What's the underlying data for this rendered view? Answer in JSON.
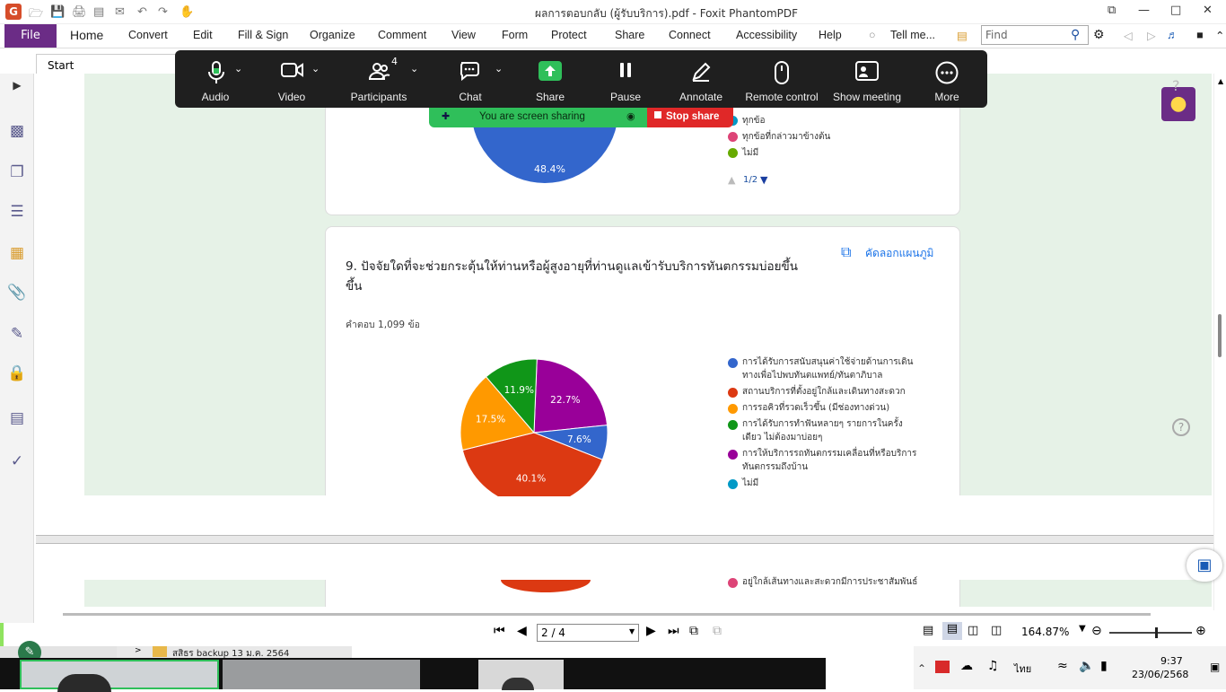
{
  "window": {
    "title": "ผลการตอบกลับ (ผู้รับบริการ).pdf - Foxit PhantomPDF"
  },
  "ribbon": {
    "file": "File",
    "tabs": [
      "Home",
      "Convert",
      "Edit",
      "Fill & Sign",
      "Organize",
      "Comment",
      "View",
      "Form",
      "Protect",
      "Share",
      "Connect",
      "Accessibility",
      "Help"
    ],
    "tell_me": "Tell me...",
    "find_placeholder": "Find"
  },
  "doc_tab": {
    "label": "Start"
  },
  "zoom_toolbar": {
    "audio": "Audio",
    "video": "Video",
    "participants": "Participants",
    "participants_count": "4",
    "chat": "Chat",
    "share": "Share",
    "pause": "Pause",
    "annotate": "Annotate",
    "remote_control": "Remote control",
    "show_meeting": "Show meeting",
    "more": "More",
    "sharing_status": "You are screen sharing",
    "stop_share": "Stop share"
  },
  "card1": {
    "pie_label": "48.4%",
    "legend": [
      {
        "text": "ทุกข้อ",
        "color": "#0099c6"
      },
      {
        "text": "ทุกข้อที่กล่าวมาข้างต้น",
        "color": "#dd4477"
      },
      {
        "text": "ไม่มี",
        "color": "#66aa00"
      }
    ],
    "pager": "1/2"
  },
  "card2": {
    "question": "9.  ปัจจัยใดที่จะช่วยกระตุ้นให้ท่านหรือผู้สูงอายุที่ท่านดูแลเข้ารับบริการทันตกรรมบ่อยขึ้น",
    "question_line2": "ขึ้น",
    "copy_label": "คัดลอกแผนภูมิ",
    "responses": "คำตอบ 1,099 ข้อ"
  },
  "chart_data": {
    "type": "pie",
    "title": "9.  ปัจจัยใดที่จะช่วยกระตุ้นให้ท่านหรือผู้สูงอายุที่ท่านดูแลเข้ารับบริการทันตกรรมบ่อยขึ้น",
    "slices": [
      {
        "name": "การได้รับการสนับสนุนค่าใช้จ่ายด้านการเดินทางเพื่อไปพบทันตแพทย์/ทันตาภิบาล",
        "value": 7.6,
        "label": "7.6%",
        "color": "#3366cc"
      },
      {
        "name": "สถานบริการที่ตั้งอยู่ใกล้และเดินทางสะดวก",
        "value": 40.1,
        "label": "40.1%",
        "color": "#dc3912"
      },
      {
        "name": "การรอคิวที่รวดเร็วขึ้น (มีช่องทางด่วน)",
        "value": 17.5,
        "label": "17.5%",
        "color": "#ff9900"
      },
      {
        "name": "การได้รับการทำฟันหลายๆ รายการในครั้งเดียว ไม่ต้องมาบ่อยๆ",
        "value": 11.9,
        "label": "11.9%",
        "color": "#109618"
      },
      {
        "name": "การให้บริการรถทันตกรรมเคลื่อนที่หรือบริการทันตกรรมถึงบ้าน",
        "value": 22.7,
        "label": "22.7%",
        "color": "#990099"
      }
    ],
    "legend_lines": [
      {
        "lines": [
          "การได้รับการสนับสนุนค่าใช้จ่ายด้านการเดิน",
          "ทางเพื่อไปพบทันตแพทย์/ทันตาภิบาล"
        ],
        "color": "#3366cc"
      },
      {
        "lines": [
          "สถานบริการที่ตั้งอยู่ใกล้และเดินทางสะดวก"
        ],
        "color": "#dc3912"
      },
      {
        "lines": [
          "การรอคิวที่รวดเร็วขึ้น (มีช่องทางด่วน)"
        ],
        "color": "#ff9900"
      },
      {
        "lines": [
          "การได้รับการทำฟันหลายๆ รายการในครั้ง",
          "เดียว ไม่ต้องมาบ่อยๆ"
        ],
        "color": "#109618"
      },
      {
        "lines": [
          "การให้บริการรถทันตกรรมเคลื่อนที่หรือบริการ",
          "ทันตกรรมถึงบ้าน"
        ],
        "color": "#990099"
      },
      {
        "lines": [
          "ไม่มี"
        ],
        "color": "#0099c6"
      }
    ],
    "legend_placement": "right"
  },
  "card3": {
    "legend_partial": "อยู่ใกล้เส้นทางและสะดวกมีการประชาสัมพันธ์"
  },
  "nav": {
    "page": "2 / 4",
    "zoom": "164.87%"
  },
  "taskbar": {
    "folder": "สสิธร backup 13 ม.ค. 2564",
    "lang": "ไทย",
    "time": "9:37",
    "date": "23/06/2568"
  }
}
